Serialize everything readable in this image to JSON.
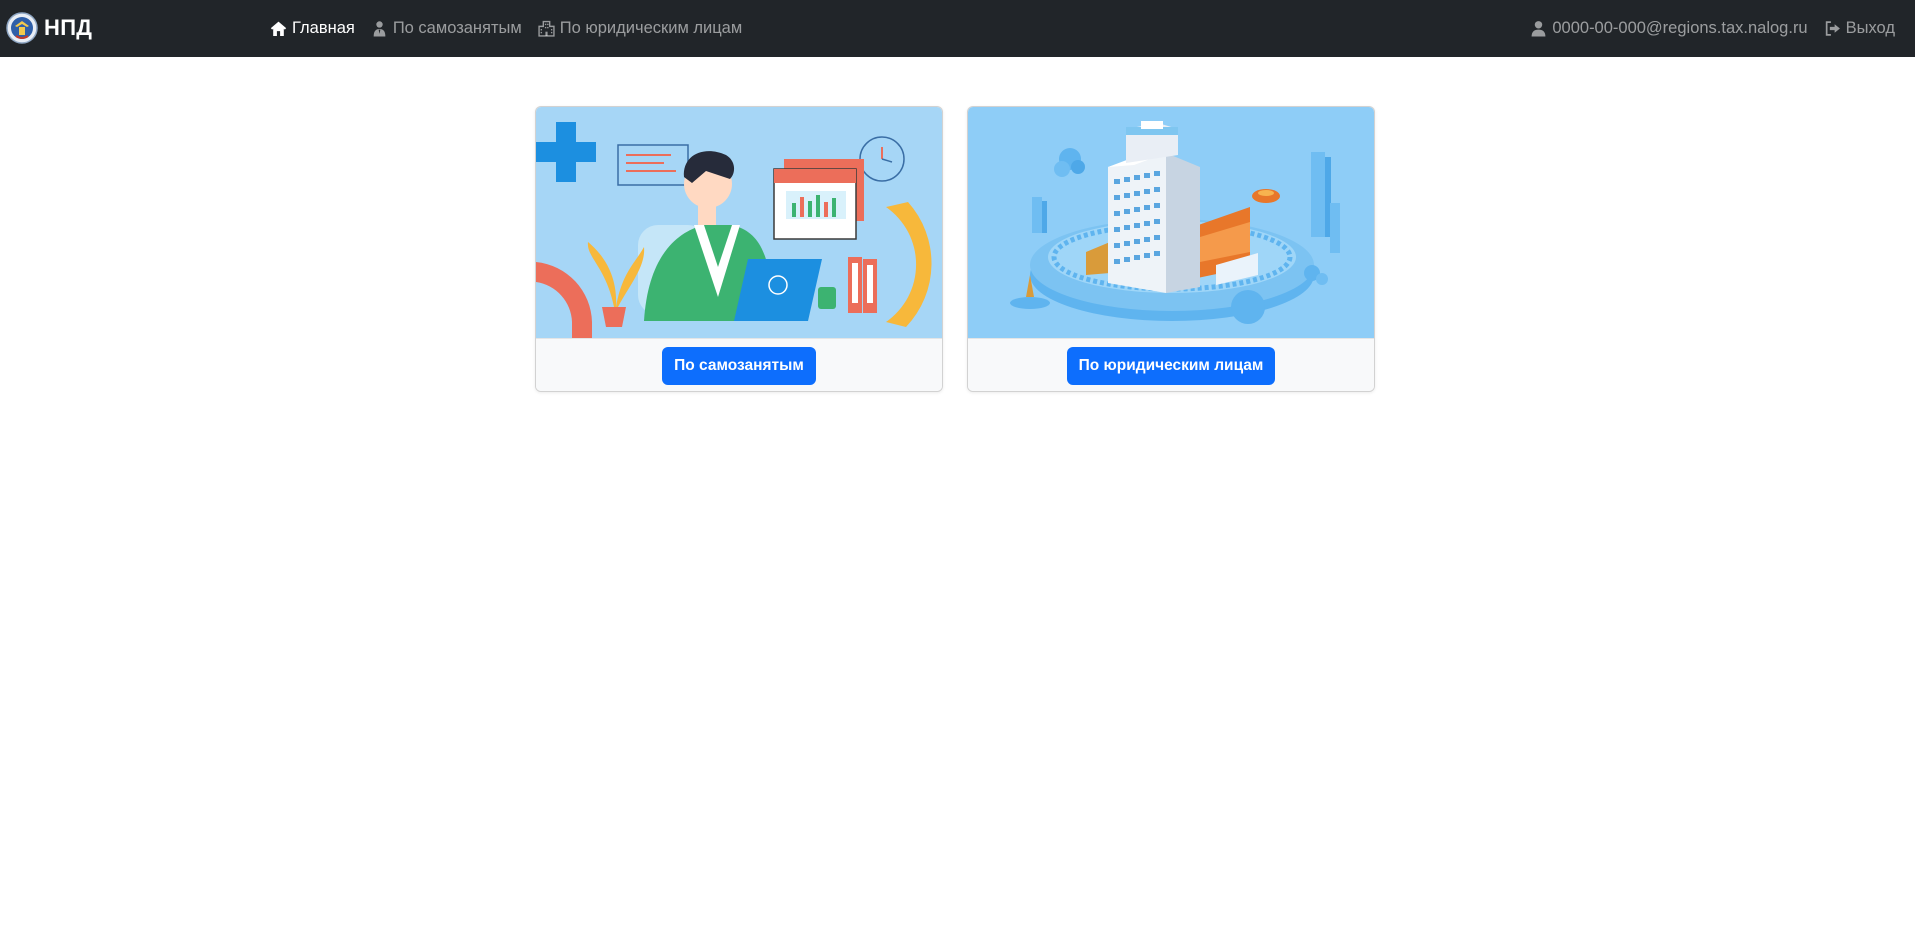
{
  "navbar": {
    "brand": {
      "text": "НПД",
      "logo_icon": "emblem-logo"
    },
    "links": [
      {
        "label": "Главная",
        "icon": "home-icon",
        "active": true
      },
      {
        "label": "По самозанятым",
        "icon": "person-icon",
        "active": false
      },
      {
        "label": "По юридическим лицам",
        "icon": "buildings-icon",
        "active": false
      }
    ],
    "user": {
      "email": "0000-00-000@regions.tax.nalog.ru",
      "icon": "user-icon"
    },
    "logout": {
      "label": "Выход",
      "icon": "logout-icon"
    }
  },
  "cards": [
    {
      "button_label": "По самозанятым",
      "image": "self-employed-illustration"
    },
    {
      "button_label": "По юридическим лицам",
      "image": "legal-entities-illustration"
    }
  ],
  "colors": {
    "navbar_bg": "#212529",
    "primary": "#0d6efd",
    "card_footer_bg": "#f8f9fa",
    "illustration_1_bg": "#a6d6f6",
    "illustration_2_bg": "#8ecdf7"
  }
}
